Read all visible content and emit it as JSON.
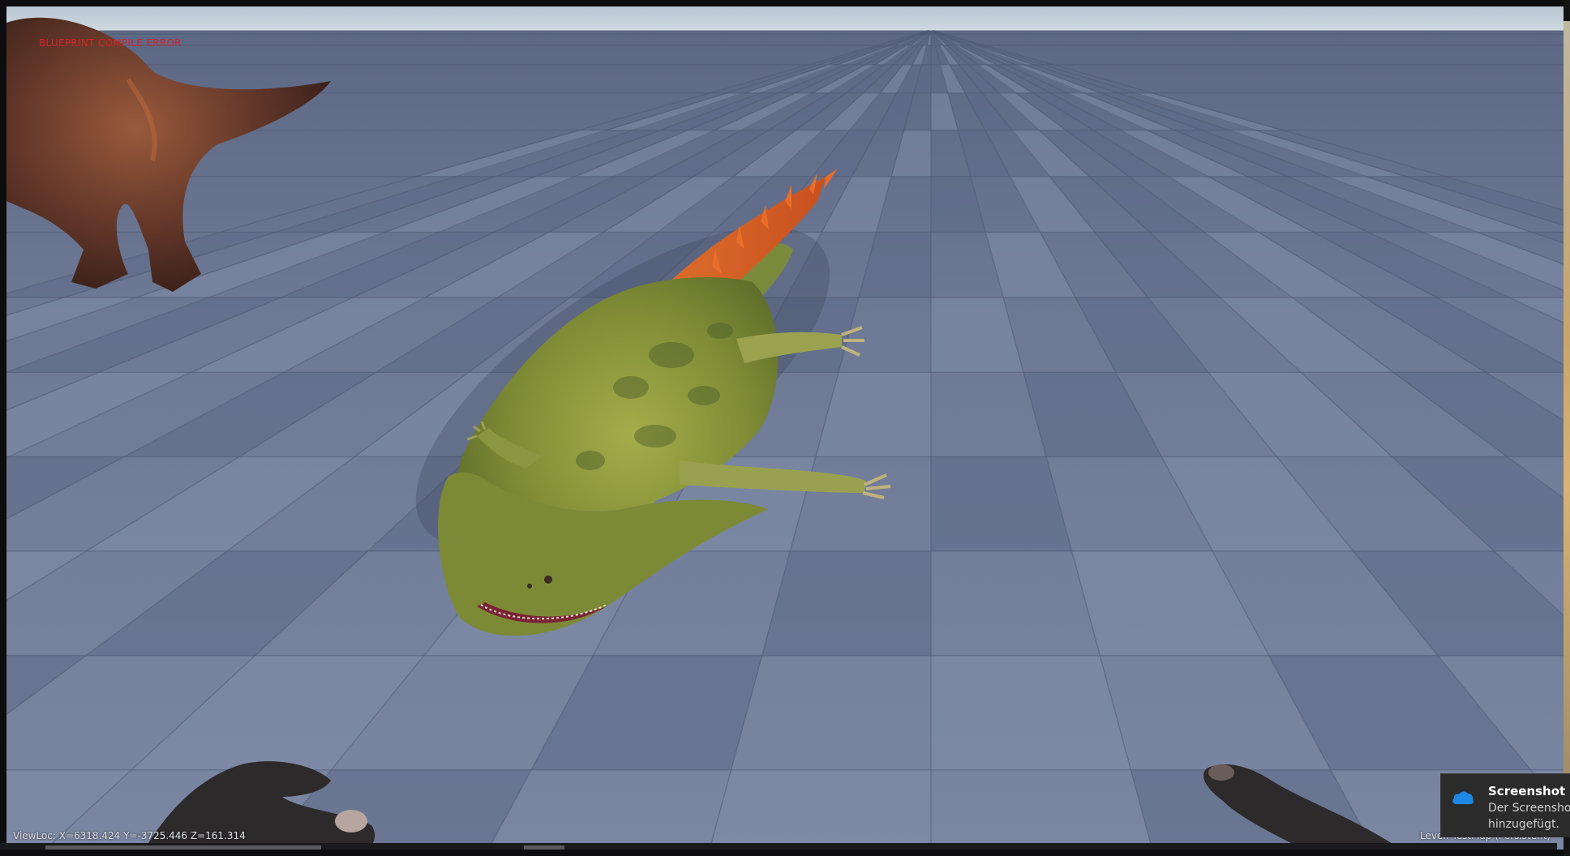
{
  "hud": {
    "error_text": "BLUEPRINT COMPILE ERROR",
    "viewloc_text": "ViewLoc: X=6318.424 Y=-3725.446 Z=161.314",
    "level_text": "Level: TestMap (Persistent)"
  },
  "notification": {
    "icon": "onedrive-cloud-icon",
    "title": "Screenshot ge",
    "line1": "Der Screensho",
    "line2": "hinzugefügt."
  },
  "scene": {
    "creatures": [
      "theropod-dinosaur",
      "amphibian-creature",
      "player-hands"
    ],
    "colors": {
      "sky": "#c5d3de",
      "floor_light": "#7f8ca8",
      "floor_dark": "#5d6a86",
      "creature_body": "#8d9a3a",
      "crest": "#e0702a",
      "dino_skin": "#5b3226",
      "hands": "#2c2a2a"
    }
  }
}
